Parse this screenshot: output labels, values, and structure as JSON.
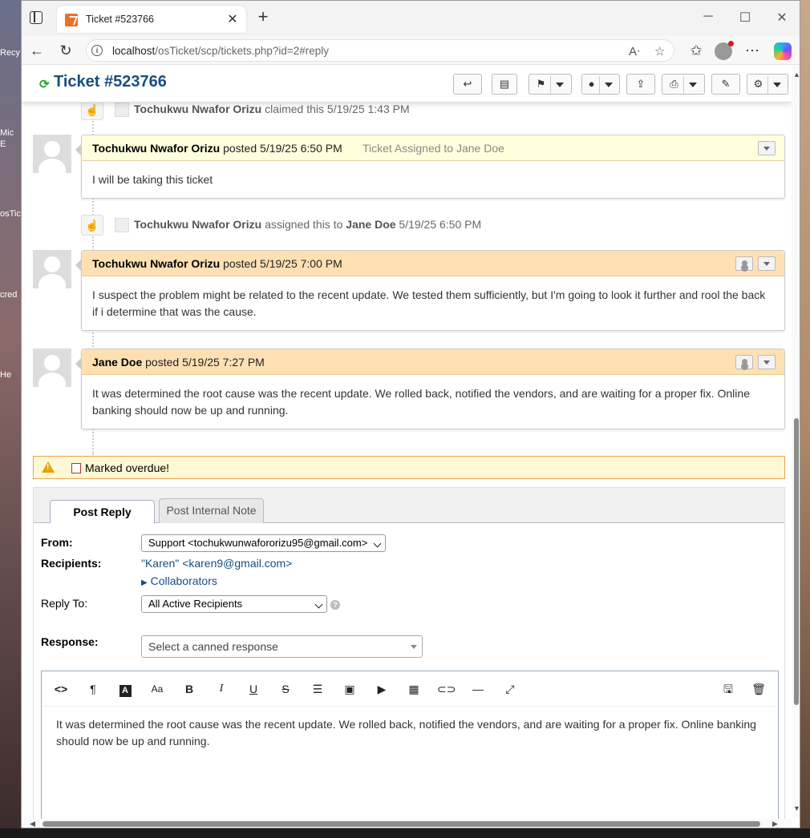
{
  "desktop": {
    "labels": [
      "Recy",
      "Mic",
      "E",
      "osTic",
      "cred",
      "He"
    ]
  },
  "browser": {
    "tab_title": "Ticket #523766",
    "url_host": "localhost",
    "url_path": "/osTicket/scp/tickets.php?id=2#reply"
  },
  "ticket": {
    "title": "Ticket #523766"
  },
  "thread": {
    "events": [
      {
        "user": "Tochukwu Nwafor Orizu",
        "action": "claimed this",
        "target": "",
        "time": "5/19/25 1:43 PM"
      },
      {
        "user": "Tochukwu Nwafor Orizu",
        "action": "assigned this to",
        "target": "Jane Doe",
        "time": "5/19/25 6:50 PM"
      }
    ],
    "entries": [
      {
        "author": "Tochukwu Nwafor Orizu",
        "verb": "posted",
        "time": "5/19/25 6:50 PM",
        "title": "Ticket Assigned to Jane Doe",
        "body": "I will be taking this ticket"
      },
      {
        "author": "Tochukwu Nwafor Orizu",
        "verb": "posted",
        "time": "5/19/25 7:00 PM",
        "title": "",
        "body": "I suspect the problem might be related to the recent update. We tested them sufficiently, but I'm going to look it further and rool the back if i determine that was the cause."
      },
      {
        "author": "Jane Doe",
        "verb": "posted",
        "time": "5/19/25 7:27 PM",
        "title": "",
        "body": "It was determined the root cause was the recent update. We rolled back, notified the vendors, and are waiting for a proper fix. Online banking should now be up and running."
      }
    ],
    "overdue_text": "Marked overdue!"
  },
  "reply": {
    "tabs": [
      "Post Reply",
      "Post Internal Note"
    ],
    "from_label": "From:",
    "from_value": "Support <tochukwunwafororizu95@gmail.com>",
    "recipients_label": "Recipients:",
    "recipients_value": "\"Karen\" <karen9@gmail.com>",
    "collaborators": "Collaborators",
    "reply_to_label": "Reply To:",
    "reply_to_value": "All Active Recipients",
    "response_label": "Response:",
    "canned_placeholder": "Select a canned response",
    "editor_text": "It was determined the root cause was the recent update. We rolled back, notified the vendors, and are waiting for a proper fix. Online banking should now be up and running."
  },
  "colors": {
    "title_blue": "#184E81",
    "response_header": "#ffe0b3",
    "note_header": "#ffffdd",
    "overdue_bg": "#fff8d5"
  }
}
